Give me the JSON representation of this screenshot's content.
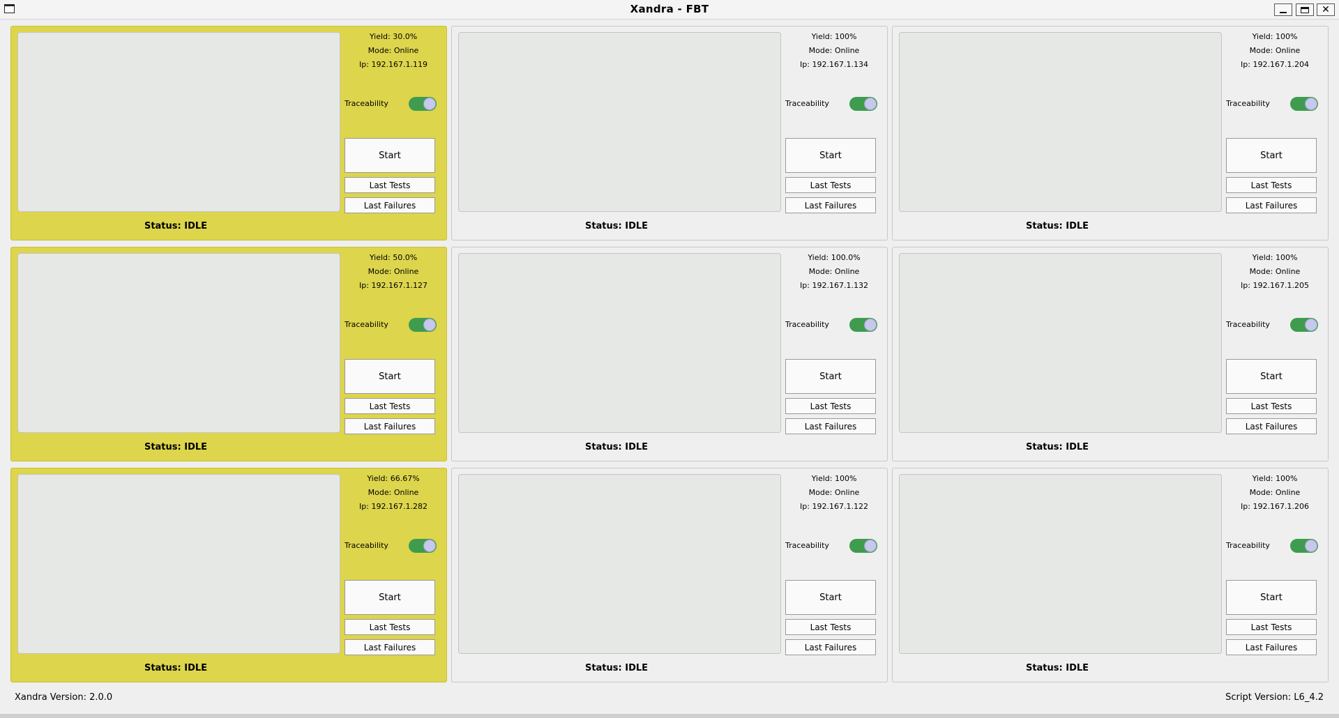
{
  "window": {
    "title": "Xandra - FBT"
  },
  "labels": {
    "traceability": "Traceability",
    "start": "Start",
    "last_tests": "Last Tests",
    "last_failures": "Last Failures"
  },
  "colors": {
    "active_panel": "#ddd54c",
    "toggle_on": "#3f9c4f",
    "toggle_knob": "#c6c8ec"
  },
  "icons": {
    "window_icon": "window-icon",
    "minimize": "minimize-icon",
    "maximize": "maximize-icon",
    "close": "close-icon"
  },
  "stations": [
    {
      "yield": "Yield: 30.0%",
      "mode": "Mode: Online",
      "ip": "Ip: 192.167.1.119",
      "status": "Status: IDLE",
      "highlighted": true,
      "traceability_on": true
    },
    {
      "yield": "Yield: 100%",
      "mode": "Mode: Online",
      "ip": "Ip: 192.167.1.134",
      "status": "Status: IDLE",
      "highlighted": false,
      "traceability_on": true
    },
    {
      "yield": "Yield: 100%",
      "mode": "Mode: Online",
      "ip": "Ip: 192.167.1.204",
      "status": "Status: IDLE",
      "highlighted": false,
      "traceability_on": true
    },
    {
      "yield": "Yield: 50.0%",
      "mode": "Mode: Online",
      "ip": "Ip: 192.167.1.127",
      "status": "Status: IDLE",
      "highlighted": true,
      "traceability_on": true
    },
    {
      "yield": "Yield: 100.0%",
      "mode": "Mode: Online",
      "ip": "Ip: 192.167.1.132",
      "status": "Status: IDLE",
      "highlighted": false,
      "traceability_on": true
    },
    {
      "yield": "Yield: 100%",
      "mode": "Mode: Online",
      "ip": "Ip: 192.167.1.205",
      "status": "Status: IDLE",
      "highlighted": false,
      "traceability_on": true
    },
    {
      "yield": "Yield: 66.67%",
      "mode": "Mode: Online",
      "ip": "Ip: 192.167.1.282",
      "status": "Status: IDLE",
      "highlighted": true,
      "traceability_on": true
    },
    {
      "yield": "Yield: 100%",
      "mode": "Mode: Online",
      "ip": "Ip: 192.167.1.122",
      "status": "Status: IDLE",
      "highlighted": false,
      "traceability_on": true
    },
    {
      "yield": "Yield: 100%",
      "mode": "Mode: Online",
      "ip": "Ip: 192.167.1.206",
      "status": "Status: IDLE",
      "highlighted": false,
      "traceability_on": true
    }
  ],
  "footer": {
    "version": "Xandra Version: 2.0.0",
    "script_version": "Script Version: L6_4.2"
  }
}
